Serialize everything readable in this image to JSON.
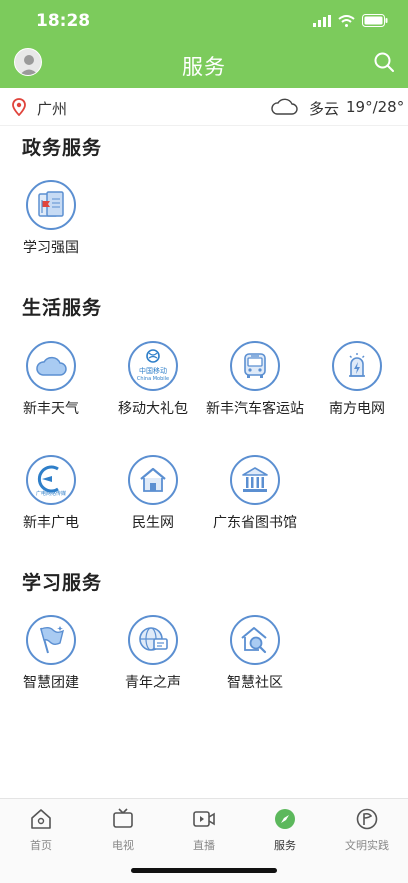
{
  "status_bar": {
    "time": "18:28"
  },
  "header": {
    "title": "服务"
  },
  "location": {
    "city": "广州",
    "weather": "多云",
    "temperature": "19°/28°"
  },
  "sections": [
    {
      "title": "政务服务",
      "items": [
        {
          "label": "学习强国",
          "icon": "xuexi-qiangguo-icon"
        }
      ]
    },
    {
      "title": "生活服务",
      "items": [
        {
          "label": "新丰天气",
          "icon": "cloud-icon"
        },
        {
          "label": "移动大礼包",
          "icon": "china-mobile-icon",
          "logo_text": "中国移动",
          "logo_subtext": "China Mobile"
        },
        {
          "label": "新丰汽车客运站",
          "icon": "bus-icon"
        },
        {
          "label": "南方电网",
          "icon": "power-icon"
        },
        {
          "label": "新丰广电",
          "icon": "broadcast-icon",
          "logo_text": "广电网络传媒"
        },
        {
          "label": "民生网",
          "icon": "house-icon"
        },
        {
          "label": "广东省图书馆",
          "icon": "library-icon"
        }
      ]
    },
    {
      "title": "学习服务",
      "items": [
        {
          "label": "智慧团建",
          "icon": "flag-icon"
        },
        {
          "label": "青年之声",
          "icon": "globe-message-icon"
        },
        {
          "label": "智慧社区",
          "icon": "community-search-icon"
        }
      ]
    }
  ],
  "tabbar": {
    "items": [
      {
        "label": "首页",
        "icon": "home-icon"
      },
      {
        "label": "电视",
        "icon": "tv-icon"
      },
      {
        "label": "直播",
        "icon": "live-icon"
      },
      {
        "label": "服务",
        "icon": "compass-icon",
        "active": true
      },
      {
        "label": "文明实践",
        "icon": "practice-icon"
      }
    ]
  },
  "colors": {
    "brand_green": "#7ccb5c",
    "icon_blue": "#5b8fd1",
    "active_green": "#5cb85c"
  }
}
